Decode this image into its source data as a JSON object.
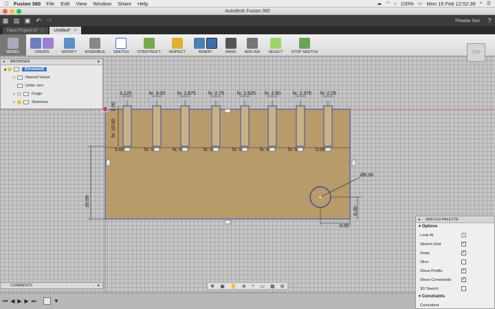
{
  "menubar": {
    "app": "Fusion 360",
    "menus": [
      "File",
      "Edit",
      "View",
      "Window",
      "Share",
      "Help"
    ],
    "status_percent": "100%",
    "clock": "Mon 15 Feb  12:52:36"
  },
  "window": {
    "title": "Autodesk Fusion 360"
  },
  "quick_access": {
    "user": "Phoebe Sun"
  },
  "doc_tabs": [
    {
      "label": "Harp Project v7"
    },
    {
      "label": "Untitled*"
    }
  ],
  "ribbon": {
    "model": "MODEL",
    "groups": [
      "CREATE",
      "MODIFY",
      "ASSEMBLE",
      "SKETCH",
      "CONSTRUCT",
      "INSPECT",
      "INSERT",
      "MAKE",
      "ADD-INS",
      "SELECT",
      "STOP SKETCH"
    ]
  },
  "browser": {
    "header": "BROWSER",
    "doc": "(Unsaved)",
    "items": [
      {
        "label": "Named Views"
      },
      {
        "label": "Units: mm"
      },
      {
        "label": "Origin"
      },
      {
        "label": "Sketches"
      }
    ]
  },
  "viewcube": {
    "label": "TOP"
  },
  "sketch": {
    "slot_dims": [
      "3.125",
      "fx: 3.00",
      "fx: 2.875",
      "fx: 2.75",
      "fx: 2.625",
      "fx: 2.50",
      "fx: 2.375",
      "fx: 2.25"
    ],
    "gap_dims": [
      "5.00",
      "fx: 5.00",
      "fx: 5.00",
      "fx: 5.00",
      "fx: 5.00",
      "fx: 5.00",
      "fx: 5.00",
      "5.00"
    ],
    "slot_height": "fx: 10.00",
    "top_offset": "1.00",
    "plate_height": "20.00",
    "circle_dia": "Ø6.00",
    "circle_x": "8.00",
    "circle_y": "6.00"
  },
  "comments": {
    "label": "COMMENTS"
  },
  "palette": {
    "header": "SKETCH PALETTE",
    "options_title": "Options",
    "options": [
      {
        "label": "Look At",
        "checked": false,
        "button": true
      },
      {
        "label": "Sketch Grid",
        "checked": true
      },
      {
        "label": "Snap",
        "checked": true
      },
      {
        "label": "Slice",
        "checked": false
      },
      {
        "label": "Show Profile",
        "checked": true
      },
      {
        "label": "Show Constraints",
        "checked": true
      },
      {
        "label": "3D Sketch",
        "checked": false
      }
    ],
    "constraints_title": "Constraints",
    "constraints_first": "Coincident"
  },
  "colors": {
    "plate_fill": "#b89b6b",
    "sketch_line": "#3b4bb5",
    "accent": "#3a6fc9"
  }
}
